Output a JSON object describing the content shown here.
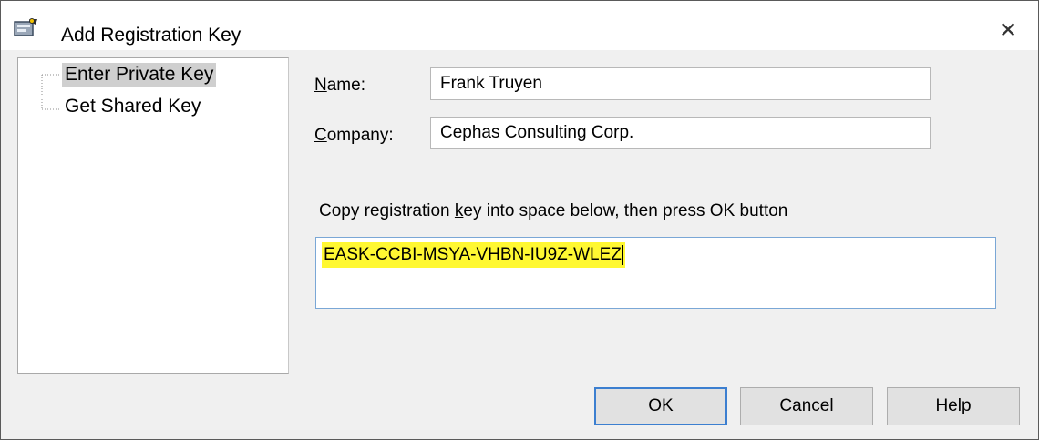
{
  "window": {
    "title": "Add Registration Key",
    "close_glyph": "✕",
    "icon": "registration-key-icon"
  },
  "tree": {
    "items": [
      {
        "label": "Enter Private Key",
        "selected": true
      },
      {
        "label": "Get Shared Key",
        "selected": false
      }
    ]
  },
  "form": {
    "name_label": "Name:",
    "name_mnemonic": "N",
    "name_rest": "ame:",
    "name_value": "Frank Truyen",
    "company_label": "Company:",
    "company_mnemonic": "C",
    "company_rest": "ompany:",
    "company_value": "Cephas Consulting Corp.",
    "instruction_before": "Copy registration ",
    "instruction_mnemonic": "k",
    "instruction_after": "ey into space below, then press OK button",
    "key_value": "EASK-CCBI-MSYA-VHBN-IU9Z-WLEZ",
    "key_highlight_color": "#fff832"
  },
  "buttons": {
    "ok": "OK",
    "cancel": "Cancel",
    "help": "Help"
  }
}
